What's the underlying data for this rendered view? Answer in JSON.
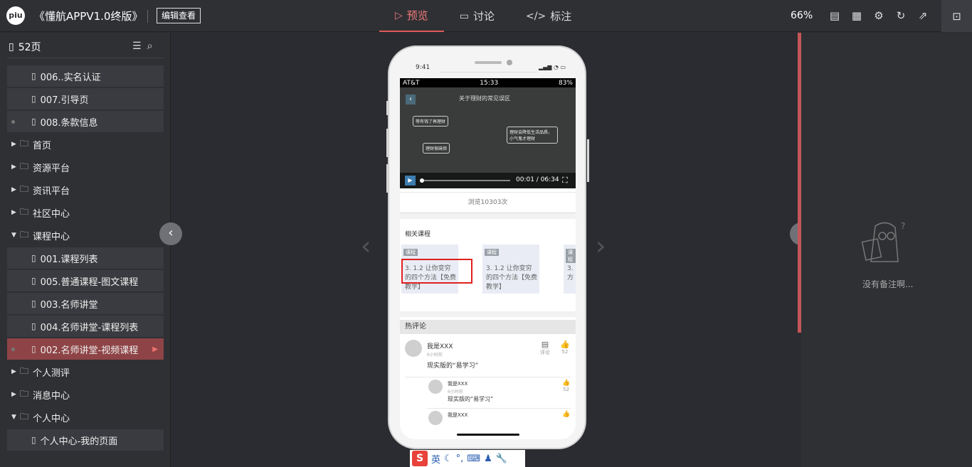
{
  "app": {
    "logo_text": "piu",
    "project_title": "《懂航APPV1.0终版》",
    "edit_button": "编辑查看",
    "zoom": "66%"
  },
  "tabs": [
    {
      "label": "预览",
      "icon": "play-outline-icon",
      "active": true
    },
    {
      "label": "讨论",
      "icon": "comment-icon",
      "active": false
    },
    {
      "label": "标注",
      "icon": "code-icon",
      "active": false
    }
  ],
  "sidebar": {
    "page_count": "52页",
    "items": [
      {
        "label": "006..实名认证",
        "type": "page",
        "dot": false
      },
      {
        "label": "007.引导页",
        "type": "page",
        "dot": false
      },
      {
        "label": "008.条款信息",
        "type": "page",
        "dot": true
      },
      {
        "label": "首页",
        "type": "folder",
        "expanded": false
      },
      {
        "label": "资源平台",
        "type": "folder",
        "expanded": false
      },
      {
        "label": "资讯平台",
        "type": "folder",
        "expanded": false
      },
      {
        "label": "社区中心",
        "type": "folder",
        "expanded": false
      },
      {
        "label": "课程中心",
        "type": "folder",
        "expanded": true
      },
      {
        "label": "001.课程列表",
        "type": "page",
        "dot": false
      },
      {
        "label": "005.普通课程-图文课程",
        "type": "page",
        "dot": false
      },
      {
        "label": "003.名师讲堂",
        "type": "page",
        "dot": false
      },
      {
        "label": "004.名师讲堂-课程列表",
        "type": "page",
        "dot": false
      },
      {
        "label": "002.名师讲堂-视频课程",
        "type": "page",
        "dot": true,
        "active": true
      },
      {
        "label": "个人测评",
        "type": "folder",
        "expanded": false
      },
      {
        "label": "消息中心",
        "type": "folder",
        "expanded": false
      },
      {
        "label": "个人中心",
        "type": "folder",
        "expanded": true
      },
      {
        "label": "个人中心-我的页面",
        "type": "page",
        "dot": false
      }
    ]
  },
  "notes": {
    "empty_text": "没有备注啊..."
  },
  "phone": {
    "notch_time": "9:41",
    "status_carrier": "AT&T",
    "status_time": "15:33",
    "status_battery": "83%",
    "video_title": "关于理财的常见误区",
    "video_time": "00:01 / 06:34",
    "chalk_1": "等有钱了再理财",
    "chalk_2": "理财会降低生活品质，小气鬼才理财",
    "chalk_3": "理财很麻烦",
    "views": "浏览10303次",
    "related_title": "相关课程",
    "card_badge": "课程",
    "card_text": "3. 1.2 让你变穷的四个方法【免费教学】",
    "card_text_cut": "3. 方",
    "hot_title": "热评论",
    "comment_name": "我是XXX",
    "comment_time": "6小时前",
    "comment_text": "现实版的“易学习”",
    "comment_label": "评论",
    "like_count": "52"
  },
  "ime": {
    "lang": "英"
  }
}
